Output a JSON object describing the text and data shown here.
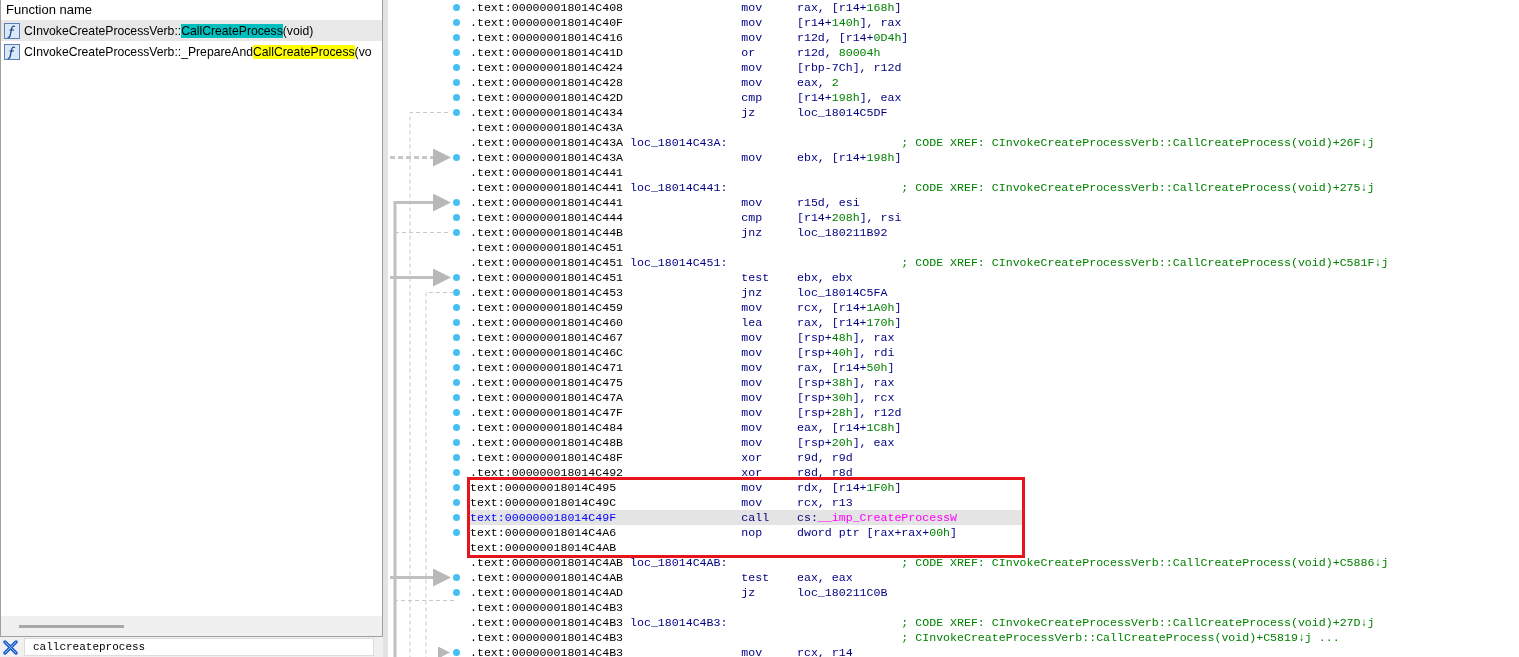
{
  "function_list": {
    "header": "Function name",
    "items": [
      {
        "prefix": "CInvokeCreateProcessVerb::",
        "match": "CallCreateProcess",
        "suffix": "(void)",
        "color": "#00bfbf",
        "selected": true
      },
      {
        "prefix": "CInvokeCreateProcessVerb::_PrepareAnd",
        "match": "CallCreateProcess",
        "suffix": "(vo",
        "color": "#ffff00",
        "selected": false
      }
    ]
  },
  "filter": {
    "value": "callcreateprocess"
  },
  "listing": {
    "lines": [
      {
        "kind": "insn",
        "address": ".text:000000018014C408",
        "mnemonic": "mov",
        "operands": [
          {
            "text": "rax, [r14+",
            "kind": "reg"
          },
          {
            "text": "168h",
            "kind": "num"
          },
          {
            "text": "]",
            "kind": "reg"
          }
        ],
        "selected": false,
        "boxed": false
      },
      {
        "kind": "insn",
        "address": ".text:000000018014C40F",
        "mnemonic": "mov",
        "operands": [
          {
            "text": "[r14+",
            "kind": "reg"
          },
          {
            "text": "140h",
            "kind": "num"
          },
          {
            "text": "], rax",
            "kind": "reg"
          }
        ],
        "selected": false,
        "boxed": false
      },
      {
        "kind": "insn",
        "address": ".text:000000018014C416",
        "mnemonic": "mov",
        "operands": [
          {
            "text": "r12d, [r14+",
            "kind": "reg"
          },
          {
            "text": "0D4h",
            "kind": "num"
          },
          {
            "text": "]",
            "kind": "reg"
          }
        ],
        "selected": false,
        "boxed": false
      },
      {
        "kind": "insn",
        "address": ".text:000000018014C41D",
        "mnemonic": "or",
        "operands": [
          {
            "text": "r12d, ",
            "kind": "reg"
          },
          {
            "text": "80004h",
            "kind": "num"
          }
        ],
        "selected": false,
        "boxed": false
      },
      {
        "kind": "insn",
        "address": ".text:000000018014C424",
        "mnemonic": "mov",
        "operands": [
          {
            "text": "[rbp-7Ch], r12d",
            "kind": "reg"
          }
        ],
        "selected": false,
        "boxed": false
      },
      {
        "kind": "insn",
        "address": ".text:000000018014C428",
        "mnemonic": "mov",
        "operands": [
          {
            "text": "eax, ",
            "kind": "reg"
          },
          {
            "text": "2",
            "kind": "num"
          }
        ],
        "selected": false,
        "boxed": false
      },
      {
        "kind": "insn",
        "address": ".text:000000018014C42D",
        "mnemonic": "cmp",
        "operands": [
          {
            "text": "[r14+",
            "kind": "reg"
          },
          {
            "text": "198h",
            "kind": "num"
          },
          {
            "text": "], eax",
            "kind": "reg"
          }
        ],
        "selected": false,
        "boxed": false
      },
      {
        "kind": "insn",
        "address": ".text:000000018014C434",
        "mnemonic": "jz",
        "operands": [
          {
            "text": "loc_18014C5DF",
            "kind": "reg"
          }
        ],
        "selected": false,
        "boxed": false
      },
      {
        "kind": "blank",
        "address": ".text:000000018014C43A",
        "selected": false,
        "boxed": false
      },
      {
        "kind": "label",
        "address": ".text:000000018014C43A",
        "label": "loc_18014C43A:",
        "comment": "; CODE XREF: CInvokeCreateProcessVerb::CallCreateProcess(void)+26F↓j",
        "selected": false,
        "boxed": false
      },
      {
        "kind": "insn",
        "address": ".text:000000018014C43A",
        "mnemonic": "mov",
        "operands": [
          {
            "text": "ebx, [r14+",
            "kind": "reg"
          },
          {
            "text": "198h",
            "kind": "num"
          },
          {
            "text": "]",
            "kind": "reg"
          }
        ],
        "selected": false,
        "boxed": false
      },
      {
        "kind": "blank",
        "address": ".text:000000018014C441",
        "selected": false,
        "boxed": false
      },
      {
        "kind": "label",
        "address": ".text:000000018014C441",
        "label": "loc_18014C441:",
        "comment": "; CODE XREF: CInvokeCreateProcessVerb::CallCreateProcess(void)+275↓j",
        "selected": false,
        "boxed": false
      },
      {
        "kind": "insn",
        "address": ".text:000000018014C441",
        "mnemonic": "mov",
        "operands": [
          {
            "text": "r15d, esi",
            "kind": "reg"
          }
        ],
        "selected": false,
        "boxed": false
      },
      {
        "kind": "insn",
        "address": ".text:000000018014C444",
        "mnemonic": "cmp",
        "operands": [
          {
            "text": "[r14+",
            "kind": "reg"
          },
          {
            "text": "208h",
            "kind": "num"
          },
          {
            "text": "], rsi",
            "kind": "reg"
          }
        ],
        "selected": false,
        "boxed": false
      },
      {
        "kind": "insn",
        "address": ".text:000000018014C44B",
        "mnemonic": "jnz",
        "operands": [
          {
            "text": "loc_180211B92",
            "kind": "reg"
          }
        ],
        "selected": false,
        "boxed": false
      },
      {
        "kind": "blank",
        "address": ".text:000000018014C451",
        "selected": false,
        "boxed": false
      },
      {
        "kind": "label",
        "address": ".text:000000018014C451",
        "label": "loc_18014C451:",
        "comment": "; CODE XREF: CInvokeCreateProcessVerb::CallCreateProcess(void)+C581F↓j",
        "selected": false,
        "boxed": false
      },
      {
        "kind": "insn",
        "address": ".text:000000018014C451",
        "mnemonic": "test",
        "operands": [
          {
            "text": "ebx, ebx",
            "kind": "reg"
          }
        ],
        "selected": false,
        "boxed": false
      },
      {
        "kind": "insn",
        "address": ".text:000000018014C453",
        "mnemonic": "jnz",
        "operands": [
          {
            "text": "loc_18014C5FA",
            "kind": "reg"
          }
        ],
        "selected": false,
        "boxed": false
      },
      {
        "kind": "insn",
        "address": ".text:000000018014C459",
        "mnemonic": "mov",
        "operands": [
          {
            "text": "rcx, [r14+",
            "kind": "reg"
          },
          {
            "text": "1A0h",
            "kind": "num"
          },
          {
            "text": "]",
            "kind": "reg"
          }
        ],
        "selected": false,
        "boxed": false
      },
      {
        "kind": "insn",
        "address": ".text:000000018014C460",
        "mnemonic": "lea",
        "operands": [
          {
            "text": "rax, [r14+",
            "kind": "reg"
          },
          {
            "text": "170h",
            "kind": "num"
          },
          {
            "text": "]",
            "kind": "reg"
          }
        ],
        "selected": false,
        "boxed": false
      },
      {
        "kind": "insn",
        "address": ".text:000000018014C467",
        "mnemonic": "mov",
        "operands": [
          {
            "text": "[rsp+",
            "kind": "reg"
          },
          {
            "text": "48h",
            "kind": "num"
          },
          {
            "text": "], rax",
            "kind": "reg"
          }
        ],
        "selected": false,
        "boxed": false
      },
      {
        "kind": "insn",
        "address": ".text:000000018014C46C",
        "mnemonic": "mov",
        "operands": [
          {
            "text": "[rsp+",
            "kind": "reg"
          },
          {
            "text": "40h",
            "kind": "num"
          },
          {
            "text": "], rdi",
            "kind": "reg"
          }
        ],
        "selected": false,
        "boxed": false
      },
      {
        "kind": "insn",
        "address": ".text:000000018014C471",
        "mnemonic": "mov",
        "operands": [
          {
            "text": "rax, [r14+",
            "kind": "reg"
          },
          {
            "text": "50h",
            "kind": "num"
          },
          {
            "text": "]",
            "kind": "reg"
          }
        ],
        "selected": false,
        "boxed": false
      },
      {
        "kind": "insn",
        "address": ".text:000000018014C475",
        "mnemonic": "mov",
        "operands": [
          {
            "text": "[rsp+",
            "kind": "reg"
          },
          {
            "text": "38h",
            "kind": "num"
          },
          {
            "text": "], rax",
            "kind": "reg"
          }
        ],
        "selected": false,
        "boxed": false
      },
      {
        "kind": "insn",
        "address": ".text:000000018014C47A",
        "mnemonic": "mov",
        "operands": [
          {
            "text": "[rsp+",
            "kind": "reg"
          },
          {
            "text": "30h",
            "kind": "num"
          },
          {
            "text": "], rcx",
            "kind": "reg"
          }
        ],
        "selected": false,
        "boxed": false
      },
      {
        "kind": "insn",
        "address": ".text:000000018014C47F",
        "mnemonic": "mov",
        "operands": [
          {
            "text": "[rsp+",
            "kind": "reg"
          },
          {
            "text": "28h",
            "kind": "num"
          },
          {
            "text": "], r12d",
            "kind": "reg"
          }
        ],
        "selected": false,
        "boxed": false
      },
      {
        "kind": "insn",
        "address": ".text:000000018014C484",
        "mnemonic": "mov",
        "operands": [
          {
            "text": "eax, [r14+",
            "kind": "reg"
          },
          {
            "text": "1C8h",
            "kind": "num"
          },
          {
            "text": "]",
            "kind": "reg"
          }
        ],
        "selected": false,
        "boxed": false
      },
      {
        "kind": "insn",
        "address": ".text:000000018014C48B",
        "mnemonic": "mov",
        "operands": [
          {
            "text": "[rsp+",
            "kind": "reg"
          },
          {
            "text": "20h",
            "kind": "num"
          },
          {
            "text": "], eax",
            "kind": "reg"
          }
        ],
        "selected": false,
        "boxed": false
      },
      {
        "kind": "insn",
        "address": ".text:000000018014C48F",
        "mnemonic": "xor",
        "operands": [
          {
            "text": "r9d, r9d",
            "kind": "reg"
          }
        ],
        "selected": false,
        "boxed": false
      },
      {
        "kind": "insn",
        "address": ".text:000000018014C492",
        "mnemonic": "xor",
        "operands": [
          {
            "text": "r8d, r8d",
            "kind": "reg"
          }
        ],
        "selected": false,
        "boxed": false
      },
      {
        "kind": "insn",
        "address": "text:000000018014C495",
        "mnemonic": "mov",
        "operands": [
          {
            "text": "rdx, [r14+",
            "kind": "reg"
          },
          {
            "text": "1F0h",
            "kind": "num"
          },
          {
            "text": "]",
            "kind": "reg"
          }
        ],
        "selected": false,
        "boxed": true
      },
      {
        "kind": "insn",
        "address": "text:000000018014C49C",
        "mnemonic": "mov",
        "operands": [
          {
            "text": "rcx, r13",
            "kind": "reg"
          }
        ],
        "selected": false,
        "boxed": true
      },
      {
        "kind": "insn",
        "address": "text:000000018014C49F",
        "mnemonic": "call",
        "operands": [
          {
            "text": "cs:",
            "kind": "reg"
          },
          {
            "text": "__imp_CreateProcessW",
            "kind": "import"
          }
        ],
        "selected": true,
        "boxed": true
      },
      {
        "kind": "insn",
        "address": "text:000000018014C4A6",
        "mnemonic": "nop",
        "operands": [
          {
            "text": "dword ptr [rax+rax+",
            "kind": "reg"
          },
          {
            "text": "00h",
            "kind": "num"
          },
          {
            "text": "]",
            "kind": "reg"
          }
        ],
        "selected": false,
        "boxed": true
      },
      {
        "kind": "blank",
        "address": "text:000000018014C4AB",
        "selected": false,
        "boxed": true
      },
      {
        "kind": "label",
        "address": ".text:000000018014C4AB",
        "label": "loc_18014C4AB:",
        "comment": "; CODE XREF: CInvokeCreateProcessVerb::CallCreateProcess(void)+C5886↓j",
        "selected": false,
        "boxed": false
      },
      {
        "kind": "insn",
        "address": ".text:000000018014C4AB",
        "mnemonic": "test",
        "operands": [
          {
            "text": "eax, eax",
            "kind": "reg"
          }
        ],
        "selected": false,
        "boxed": false
      },
      {
        "kind": "insn",
        "address": ".text:000000018014C4AD",
        "mnemonic": "jz",
        "operands": [
          {
            "text": "loc_180211C0B",
            "kind": "reg"
          }
        ],
        "selected": false,
        "boxed": false
      },
      {
        "kind": "blank",
        "address": ".text:000000018014C4B3",
        "selected": false,
        "boxed": false
      },
      {
        "kind": "label",
        "address": ".text:000000018014C4B3",
        "label": "loc_18014C4B3:",
        "comment": "; CODE XREF: CInvokeCreateProcessVerb::CallCreateProcess(void)+27D↓j",
        "selected": false,
        "boxed": false
      },
      {
        "kind": "comment",
        "address": ".text:000000018014C4B3",
        "comment": "; CInvokeCreateProcessVerb::CallCreateProcess(void)+C5819↓j ...",
        "selected": false,
        "boxed": false
      },
      {
        "kind": "insn",
        "address": ".text:000000018014C4B3",
        "mnemonic": "mov",
        "operands": [
          {
            "text": "rcx, r14",
            "kind": "reg"
          }
        ],
        "selected": false,
        "boxed": false
      }
    ]
  }
}
